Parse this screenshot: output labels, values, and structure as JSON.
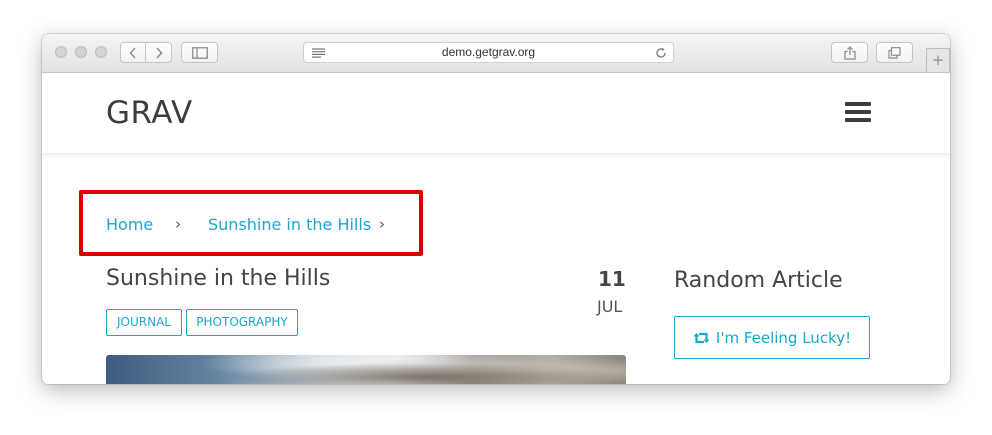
{
  "browser": {
    "url": "demo.getgrav.org",
    "new_tab_symbol": "+",
    "icons": {
      "back": "chevron-left-icon",
      "forward": "chevron-right-icon",
      "sidebar": "sidebar-icon",
      "reader": "reader-lines-icon",
      "reload": "reload-icon",
      "share": "share-icon",
      "tabs": "tabs-icon"
    }
  },
  "site": {
    "logo": "GRAV",
    "menu_icon": "hamburger-icon"
  },
  "breadcrumb": {
    "items": [
      "Home",
      "Sunshine in the Hills"
    ],
    "separator": "›",
    "highlight_color": "#d90000"
  },
  "post": {
    "title": "Sunshine in the Hills",
    "tags": [
      "JOURNAL",
      "PHOTOGRAPHY"
    ],
    "date_day": "11",
    "date_month": "JUL"
  },
  "sidebar": {
    "title": "Random Article",
    "button_label": "I'm Feeling Lucky!",
    "button_icon": "retweet-icon"
  },
  "colors": {
    "accent": "#1ba6cc",
    "text": "#444444"
  }
}
